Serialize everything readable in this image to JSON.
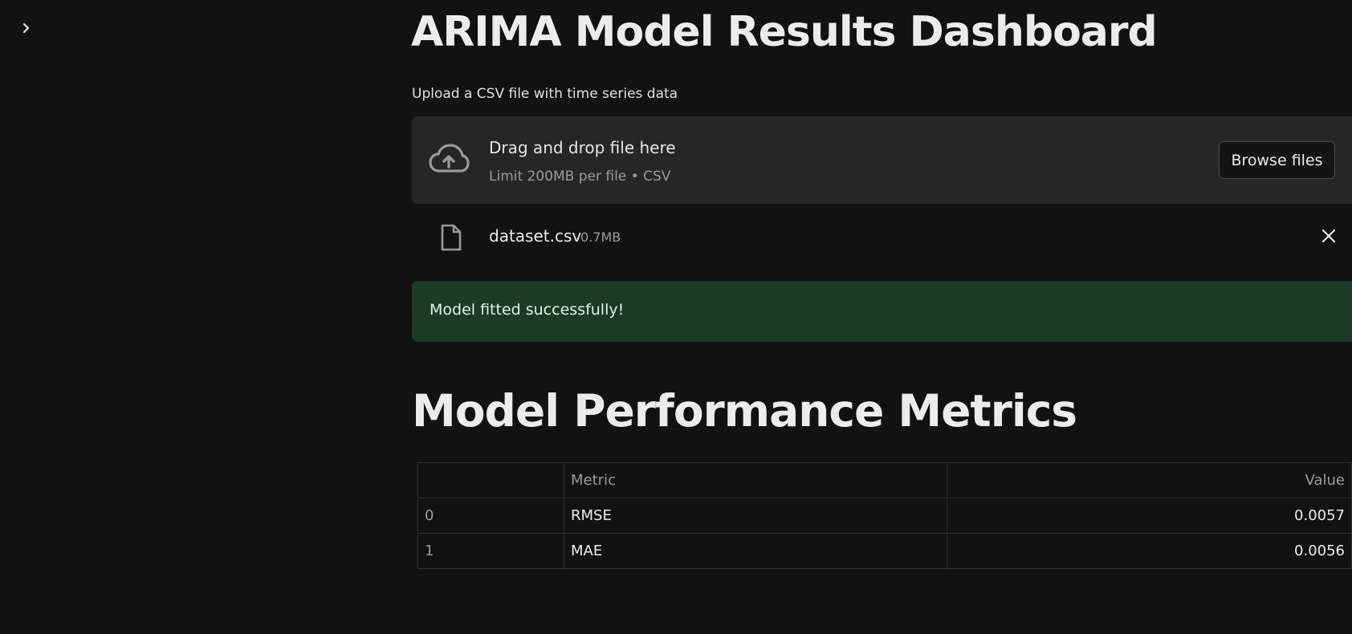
{
  "sidebar": {
    "toggle_icon": "chevron-right-icon"
  },
  "page": {
    "title": "ARIMA Model Results Dashboard"
  },
  "uploader": {
    "label": "Upload a CSV file with time series data",
    "drop_text": "Drag and drop file here",
    "limit_text": "Limit 200MB per file • CSV",
    "browse_label": "Browse files",
    "icon": "cloud-upload-icon"
  },
  "uploaded_file": {
    "name": "dataset.csv",
    "size": "0.7MB",
    "icon": "file-icon",
    "remove_icon": "close-icon"
  },
  "alert": {
    "message": "Model fitted successfully!",
    "color": "#1c3a25"
  },
  "metrics_section": {
    "title": "Model Performance Metrics",
    "table": {
      "headers": [
        "",
        "Metric",
        "Value"
      ],
      "rows": [
        {
          "index": "0",
          "metric": "RMSE",
          "value": "0.0057"
        },
        {
          "index": "1",
          "metric": "MAE",
          "value": "0.0056"
        }
      ]
    }
  },
  "colors": {
    "background": "#121212",
    "dropzone": "#262626",
    "success": "#1c3a25"
  }
}
